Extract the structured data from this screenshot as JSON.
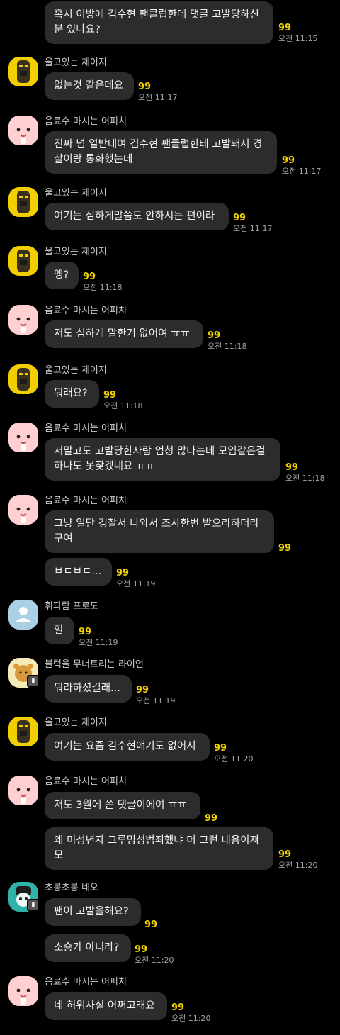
{
  "users": {
    "jay": "울고있는 제이지",
    "apeach": "음료수 마시는 어피치",
    "frodo": "휘파람 프로도",
    "ryan": "블럭을 무너트리는 라이언",
    "neo": "초롱초롱 네오"
  },
  "messages": [
    {
      "text": "혹시 이방에 김수현 팬클럽한테 댓글 고발당하신 분 있나요?",
      "count": "99",
      "time": "오전 11:15"
    },
    {
      "text": "없는것 같은데요",
      "count": "99",
      "time": "오전 11:17"
    },
    {
      "text": "진짜 넘 열받네여 김수현 팬클럽한테 고발돼서 경찰이랑 통화했는데",
      "count": "99",
      "time": "오전 11:17"
    },
    {
      "text": "여기는 심하게말씀도 안하시는 편이라",
      "count": "99",
      "time": "오전 11:17"
    },
    {
      "text": "엥?",
      "count": "99",
      "time": "오전 11:18"
    },
    {
      "text": "저도 심하게 말한거 없어여 ㅠㅠ",
      "count": "99",
      "time": "오전 11:18"
    },
    {
      "text": "뭐래요?",
      "count": "99",
      "time": "오전 11:18"
    },
    {
      "text": "저말고도 고발당한사람 엄청 많다는데 모임같은걸 하나도 못찾겠네요 ㅠㅠ",
      "count": "99",
      "time": "오전 11:18"
    },
    {
      "text": "그냥 일단 경찰서 나와서 조사한번 받으라하더라구여",
      "count": "99",
      "time": ""
    },
    {
      "text": "ㅂㄷㅂㄷ...",
      "count": "99",
      "time": "오전 11:19"
    },
    {
      "text": "헐",
      "count": "99",
      "time": "오전 11:19"
    },
    {
      "text": "뭐라하셨길래...",
      "count": "99",
      "time": "오전 11:19"
    },
    {
      "text": "여기는 요즘 김수현얘기도 없어서",
      "count": "99",
      "time": "오전 11:20"
    },
    {
      "text": "저도 3월에 쓴 댓글이에여 ㅠㅠ",
      "count": "99",
      "time": ""
    },
    {
      "text": "왜 미성년자 그루밍성범죄했냐 머 그런 내용이져모",
      "count": "99",
      "time": "오전 11:20"
    },
    {
      "text": "팬이 고발을해요?",
      "count": "99",
      "time": ""
    },
    {
      "text": "소숑가 아니라?",
      "count": "99",
      "time": "오전 11:20"
    },
    {
      "text": "네 허위사실 어쩌고래요",
      "count": "99",
      "time": "오전 11:20"
    }
  ]
}
